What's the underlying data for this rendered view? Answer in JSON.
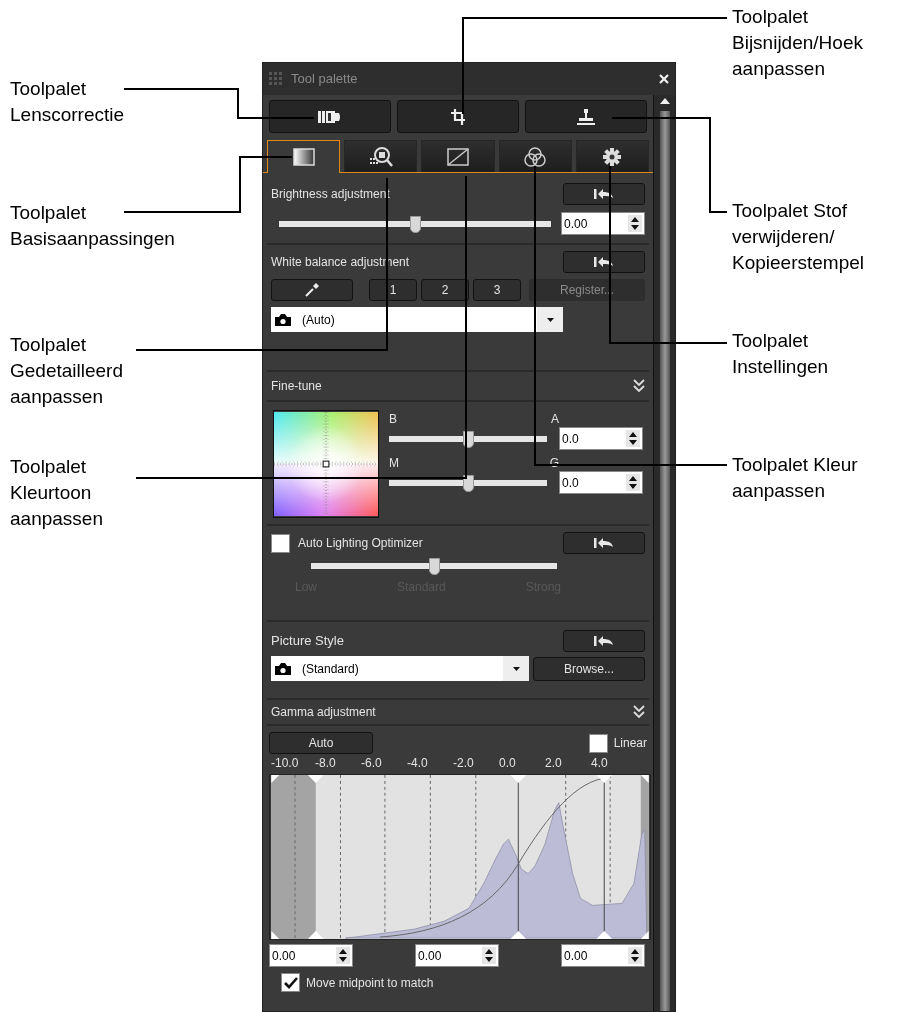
{
  "callouts": [
    {
      "text": "Toolpalet\nLenscorrectie"
    },
    {
      "text": "Toolpalet\nBasisaanpassingen"
    },
    {
      "text": "Toolpalet\nGedetailleerd\naanpassen"
    },
    {
      "text": "Toolpalet\nKleurtoon\naanpassen"
    },
    {
      "text": "Toolpalet\nBijsnijden/Hoek\naanpassen"
    },
    {
      "text": "Toolpalet Stof\nverwijderen/\nKopieerstempel"
    },
    {
      "text": "Toolpalet\nInstellingen"
    },
    {
      "text": "Toolpalet Kleur\naanpassen"
    }
  ],
  "window": {
    "title": "Tool palette"
  },
  "top_buttons": [
    {
      "kind": "lens"
    },
    {
      "kind": "crop"
    },
    {
      "kind": "stamp"
    }
  ],
  "tabs": [
    {
      "kind": "basic",
      "selected": true
    },
    {
      "kind": "detail",
      "selected": false
    },
    {
      "kind": "tone",
      "selected": false
    },
    {
      "kind": "color",
      "selected": false
    },
    {
      "kind": "settings",
      "selected": false
    }
  ],
  "brightness": {
    "label": "Brightness adjustment",
    "level": 0.5,
    "value": "0.00"
  },
  "white_balance": {
    "label": "White balance adjustment",
    "buttons": [
      {
        "kind": "eyedropper",
        "disabled": false
      },
      {
        "kind": "text",
        "label": "1",
        "disabled": false
      },
      {
        "kind": "text",
        "label": "2",
        "disabled": false
      },
      {
        "kind": "text",
        "label": "3",
        "disabled": false
      },
      {
        "kind": "text",
        "label": "Register...",
        "disabled": true
      }
    ],
    "dropdown": "(Auto)"
  },
  "fine_tune": {
    "label": "Fine-tune",
    "expanded": false,
    "sliders": [
      {
        "left": "B",
        "right": "A",
        "level": 0.5,
        "value": "0.0"
      },
      {
        "left": "M",
        "right": "G",
        "level": 0.5,
        "value": "0.0"
      }
    ]
  },
  "auto_lighting": {
    "label": "Auto Lighting Optimizer",
    "checked": false,
    "level": 0.5,
    "scale": [
      "Low",
      "Standard",
      "Strong"
    ]
  },
  "picture_style": {
    "label": "Picture Style",
    "dropdown": "(Standard)",
    "browse": "Browse..."
  },
  "gamma": {
    "label": "Gamma adjustment",
    "expanded": false,
    "auto": "Auto",
    "linear": {
      "label": "Linear",
      "checked": false
    },
    "axis": [
      "-10.0",
      "-8.0",
      "-6.0",
      "-4.0",
      "-2.0",
      "0.0",
      "2.0",
      "4.0"
    ],
    "values": [
      "0.00",
      "0.00",
      "0.00"
    ],
    "midpoint": {
      "label": "Move midpoint to match",
      "checked": true
    }
  }
}
